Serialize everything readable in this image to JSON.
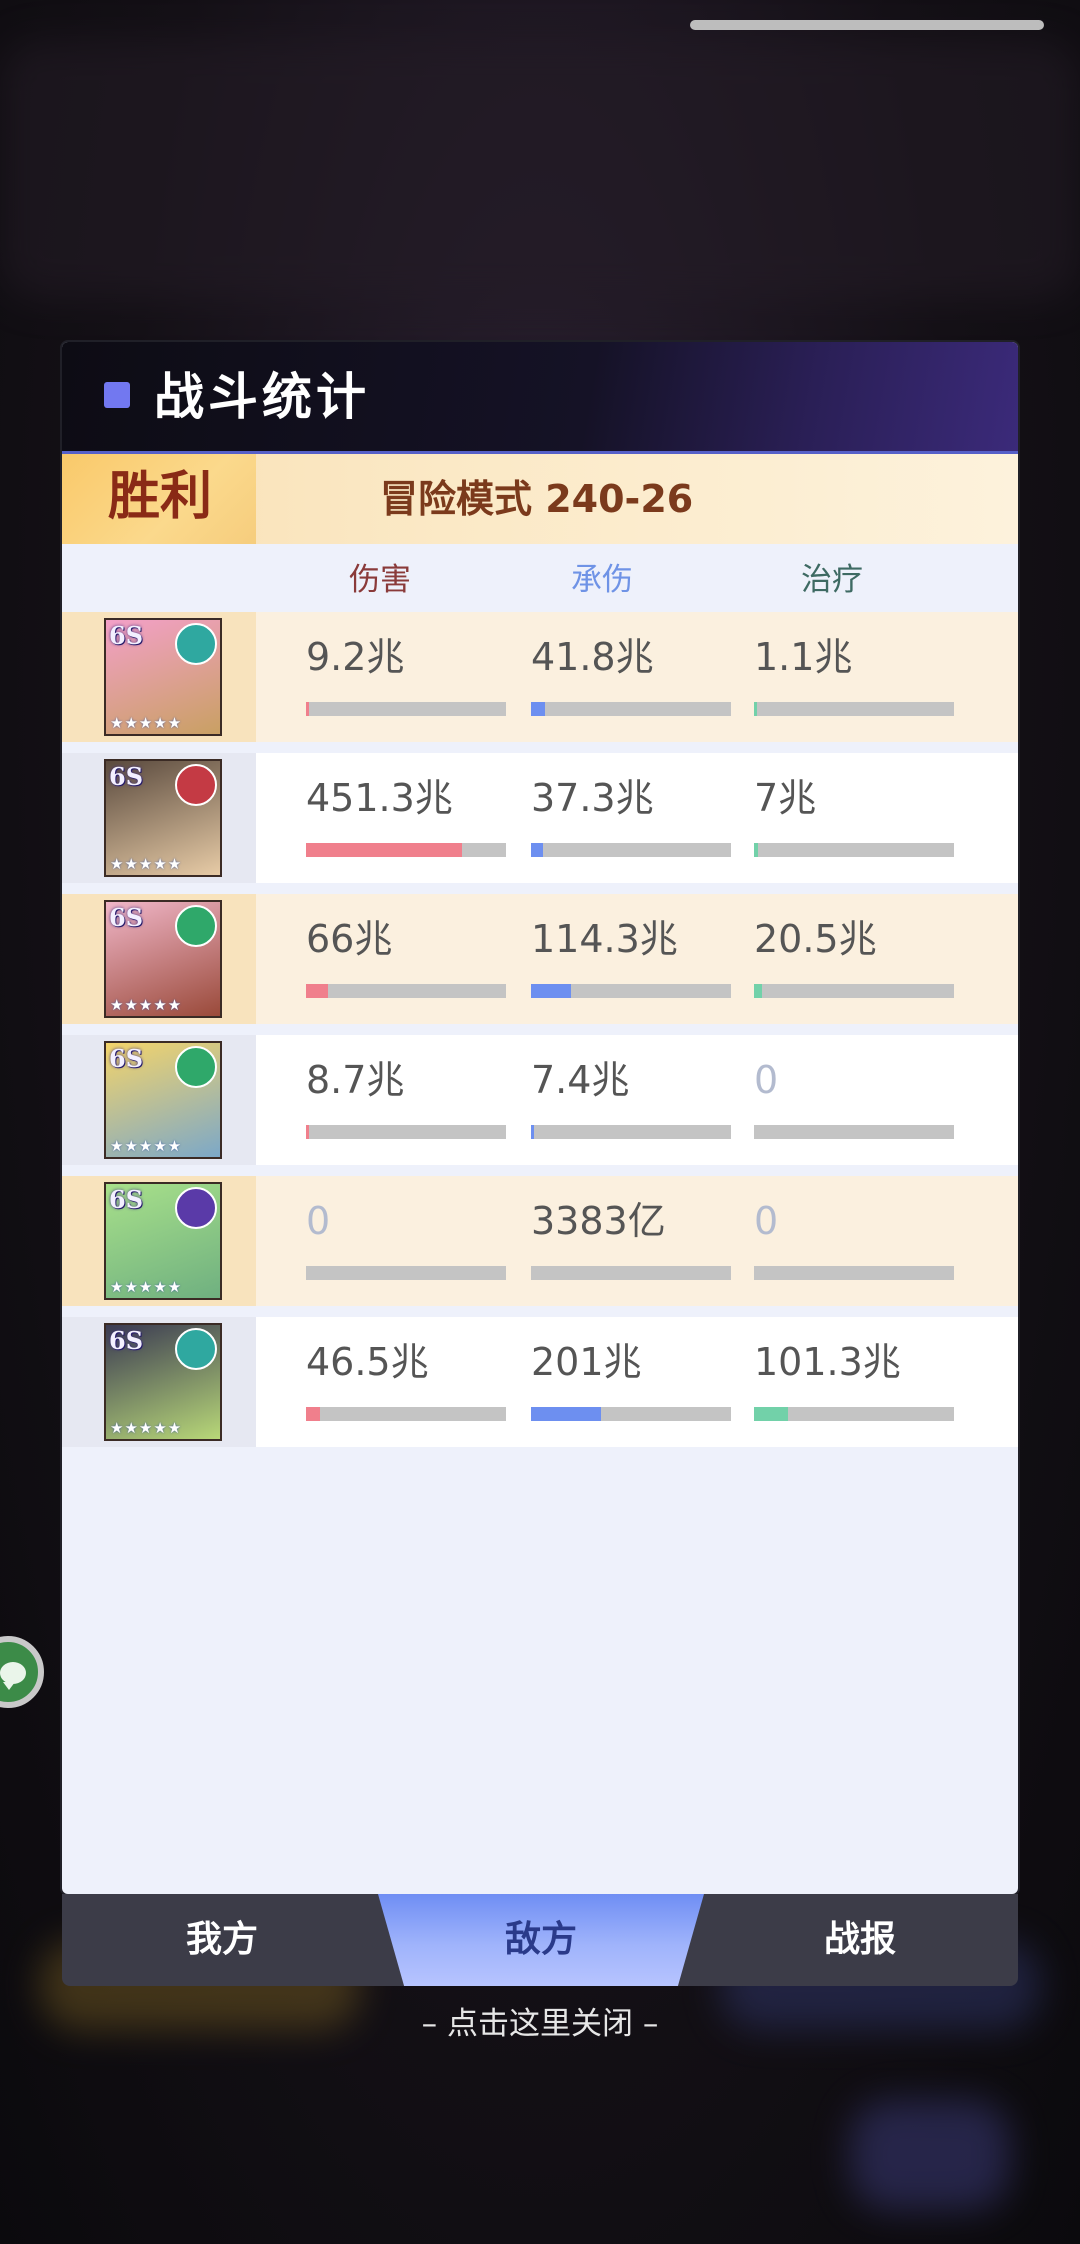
{
  "header": {
    "title": "战斗统计"
  },
  "result": {
    "status": "胜利",
    "mode": "冒险模式 240-26"
  },
  "columns": {
    "damage": "伤害",
    "taken": "承伤",
    "heal": "治疗"
  },
  "heroes": [
    {
      "tier": "6S",
      "faction_color": "#2fa8a0",
      "faction_icon": "swirl-icon",
      "art_colors": [
        "#f3a0c8",
        "#c9a063"
      ],
      "damage": "9.2兆",
      "taken": "41.8兆",
      "heal": "1.1兆",
      "damage_fill": 0.01,
      "taken_fill": 0.07,
      "heal_fill": 0.01
    },
    {
      "tier": "6S",
      "faction_color": "#c43a44",
      "faction_icon": "gem-icon",
      "art_colors": [
        "#5a4a3e",
        "#e7cba6"
      ],
      "damage": "451.3兆",
      "taken": "37.3兆",
      "heal": "7兆",
      "damage_fill": 0.78,
      "taken_fill": 0.06,
      "heal_fill": 0.02
    },
    {
      "tier": "6S",
      "faction_color": "#2fa86a",
      "faction_icon": "gem-icon",
      "art_colors": [
        "#f0b6c8",
        "#9a4a3a"
      ],
      "damage": "66兆",
      "taken": "114.3兆",
      "heal": "20.5兆",
      "damage_fill": 0.11,
      "taken_fill": 0.2,
      "heal_fill": 0.04
    },
    {
      "tier": "6S",
      "faction_color": "#2fa86a",
      "faction_icon": "gem-icon",
      "art_colors": [
        "#f4d46a",
        "#7ca8c8"
      ],
      "damage": "8.7兆",
      "taken": "7.4兆",
      "heal": "0",
      "damage_fill": 0.01,
      "taken_fill": 0.01,
      "heal_fill": 0
    },
    {
      "tier": "6S",
      "faction_color": "#5a3aa8",
      "faction_icon": "moon-icon",
      "art_colors": [
        "#a8e08a",
        "#6fb080"
      ],
      "damage": "0",
      "taken": "3383亿",
      "heal": "0",
      "damage_fill": 0,
      "taken_fill": 0,
      "heal_fill": 0
    },
    {
      "tier": "6S",
      "faction_color": "#2fa8a0",
      "faction_icon": "swirl-icon",
      "art_colors": [
        "#3a3a52",
        "#b8d878"
      ],
      "damage": "46.5兆",
      "taken": "201兆",
      "heal": "101.3兆",
      "damage_fill": 0.07,
      "taken_fill": 0.35,
      "heal_fill": 0.17
    }
  ],
  "tabs": {
    "ours": "我方",
    "enemy": "敌方",
    "report": "战报",
    "active": "enemy"
  },
  "close_hint": "– 点击这里关闭 –"
}
